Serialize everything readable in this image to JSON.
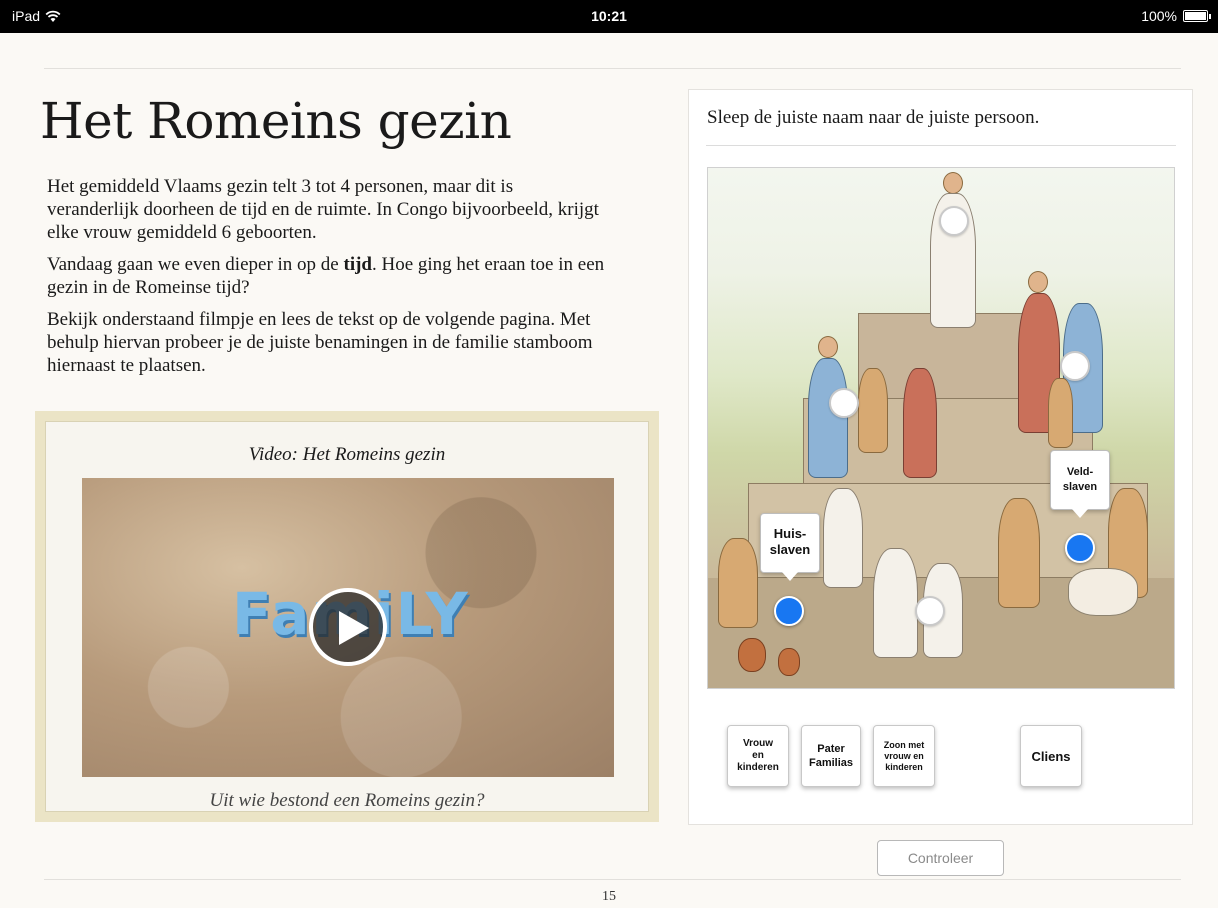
{
  "status_bar": {
    "device": "iPad",
    "time": "10:21",
    "battery": "100%"
  },
  "page": {
    "title": "Het Romeins gezin",
    "paragraphs": [
      "Het gemiddeld Vlaams gezin telt 3 tot 4 personen, maar dit is veranderlijk doorheen de tijd en de ruimte. In Congo bijvoorbeeld, krijgt elke vrouw gemiddeld 6 geboorten.",
      "Vandaag gaan we even dieper in op de ",
      "tijd",
      ". Hoe ging het eraan toe in een gezin in de Romeinse tijd?",
      "Bekijk onderstaand filmpje en lees de tekst op de volgende pagina. Met behulp hiervan probeer je de juiste benamingen in de familie stamboom hiernaast te plaatsen."
    ],
    "page_number": "15"
  },
  "video": {
    "title": "Video: Het Romeins gezin",
    "thumbnail_word": "FamiLY",
    "caption": "Uit wie bestond een Romeins gezin?",
    "play_icon": "play-icon"
  },
  "exercise": {
    "instruction": "Sleep de juiste naam naar de juiste persoon.",
    "placed_labels": [
      {
        "id": "huis",
        "text": "Huis-\nslaven"
      },
      {
        "id": "veld",
        "text": "Veld-\nslaven"
      }
    ],
    "target_states": [
      "empty",
      "empty",
      "empty",
      "filled",
      "empty",
      "filled"
    ],
    "tiles": [
      {
        "text": "Vrouw\nen\nkinderen"
      },
      {
        "text": "Pater\nFamilias"
      },
      {
        "text": "Zoon met\nvrouw en\nkinderen"
      },
      {
        "text": "Cliens"
      }
    ],
    "check_button": "Controleer"
  },
  "colors": {
    "filled_target": "#1877f2",
    "page_background": "#fbf9f5",
    "video_frame": "#ebe4c6"
  }
}
